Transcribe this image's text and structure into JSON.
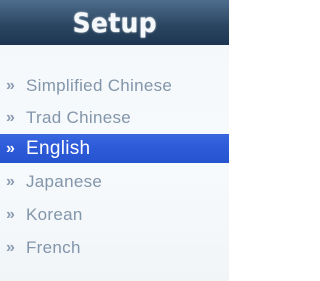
{
  "header": {
    "title": "Setup"
  },
  "menu": {
    "items": [
      {
        "label": "Simplified Chinese",
        "selected": false
      },
      {
        "label": "Trad Chinese",
        "selected": false
      },
      {
        "label": "English",
        "selected": true
      },
      {
        "label": "Japanese",
        "selected": false
      },
      {
        "label": "Korean",
        "selected": false
      },
      {
        "label": "French",
        "selected": false
      }
    ],
    "bullet_icon": "double-chevron-right-icon"
  },
  "colors": {
    "header": "#2c4763",
    "header_text": "#f5f8fb",
    "background": "#f4f8fb",
    "item_text": "#8295aa",
    "selected_background": "#2d5ad8",
    "selected_text": "#ffffff"
  }
}
